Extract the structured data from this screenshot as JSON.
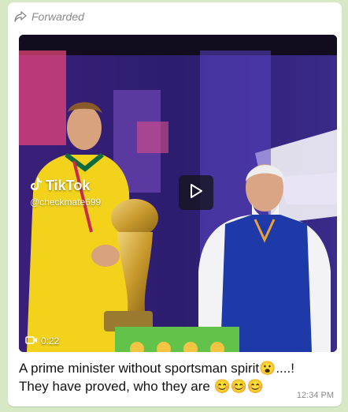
{
  "message": {
    "forwarded_label": "Forwarded",
    "video": {
      "duration": "0:22",
      "watermark_brand": "TikTok",
      "watermark_handle": "@checkmate699"
    },
    "caption_line1": "A prime minister without sportsman spirit😮....!",
    "caption_line2": "They have proved, who they are 😊😊😊",
    "time": "12:34 PM"
  },
  "colors": {
    "chat_background": "#d6e8c4",
    "bubble": "#ffffff",
    "meta_text": "#8a8a8a"
  }
}
